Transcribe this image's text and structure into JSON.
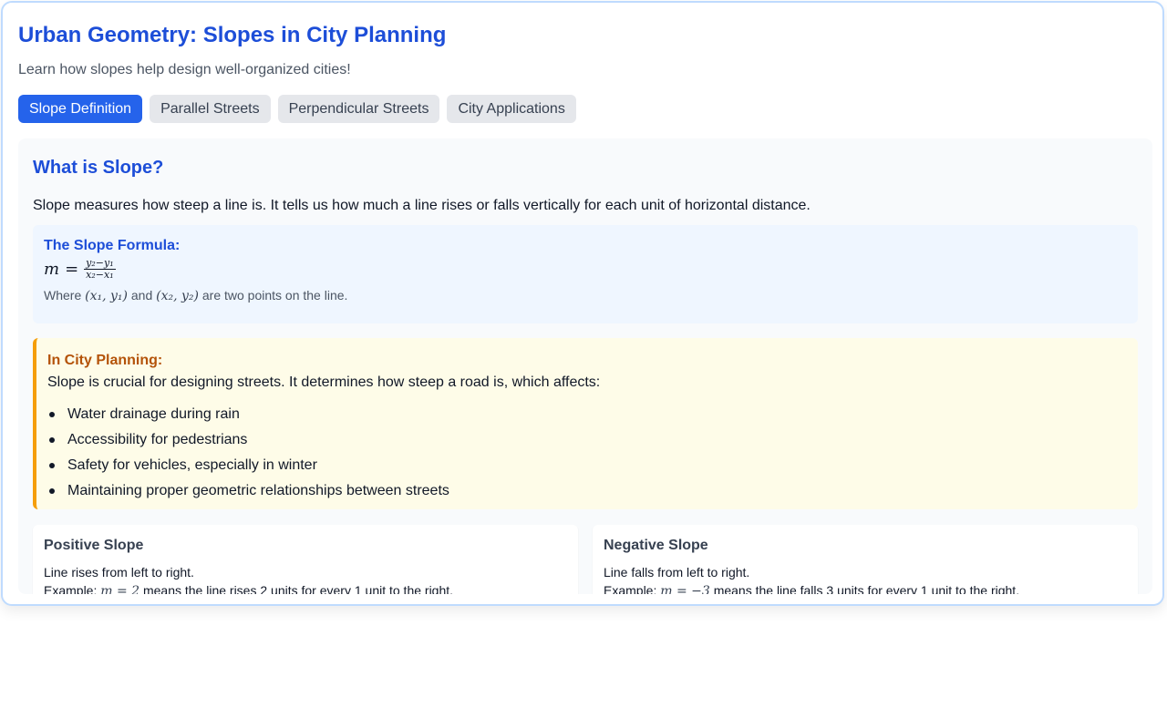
{
  "header": {
    "title": "Urban Geometry: Slopes in City Planning",
    "subtitle": "Learn how slopes help design well-organized cities!"
  },
  "tabs": [
    {
      "label": "Slope Definition",
      "active": true
    },
    {
      "label": "Parallel Streets",
      "active": false
    },
    {
      "label": "Perpendicular Streets",
      "active": false
    },
    {
      "label": "City Applications",
      "active": false
    }
  ],
  "content": {
    "section_title": "What is Slope?",
    "intro": "Slope measures how steep a line is. It tells us how much a line rises or falls vertically for each unit of horizontal distance.",
    "formula_box": {
      "heading": "The Slope Formula:",
      "lhs": "m",
      "equals": "=",
      "numerator": "y₂−y₁",
      "denominator": "x₂−x₁",
      "note_prefix": "Where",
      "point1": "(x₁, y₁)",
      "note_and": "and",
      "point2": "(x₂, y₂)",
      "note_suffix": "are two points on the line."
    },
    "planning_box": {
      "heading": "In City Planning:",
      "text": "Slope is crucial for designing streets. It determines how steep a road is, which affects:",
      "items": [
        "Water drainage during rain",
        "Accessibility for pedestrians",
        "Safety for vehicles, especially in winter",
        "Maintaining proper geometric relationships between streets"
      ]
    },
    "cards": {
      "positive": {
        "title": "Positive Slope",
        "description": "Line rises from left to right.",
        "example_prefix": "Example:",
        "example_math": "m = 2",
        "example_suffix": "means the line rises 2 units for every 1 unit to the right."
      },
      "negative": {
        "title": "Negative Slope",
        "description": "Line falls from left to right.",
        "example_prefix": "Example:",
        "example_math": "m = −3",
        "example_suffix": "means the line falls 3 units for every 1 unit to the right."
      }
    }
  },
  "colors": {
    "accent": "#2563eb",
    "heading": "#1d4ed8",
    "highlight_border": "#f59e0b",
    "highlight_heading": "#b45309"
  }
}
